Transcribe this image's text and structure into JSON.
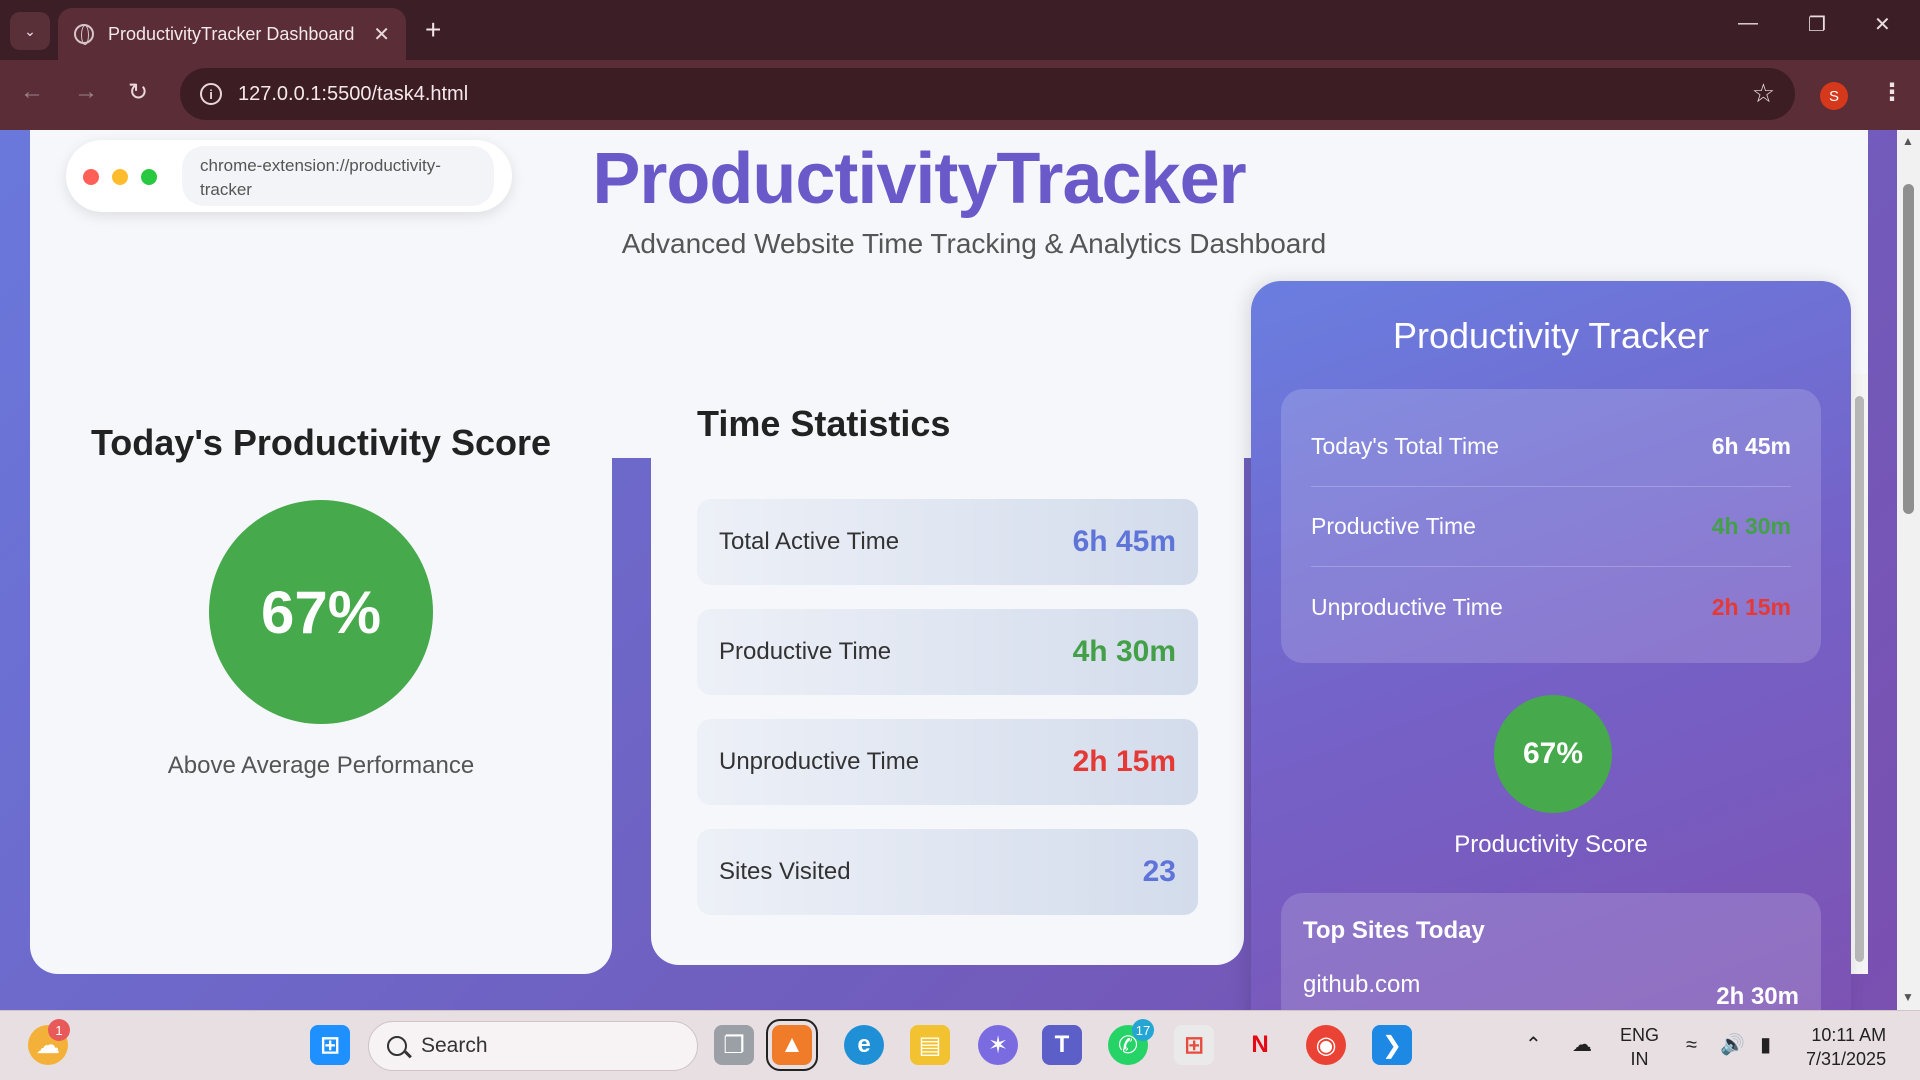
{
  "browser": {
    "tab_title": "ProductivityTracker Dashboard",
    "url": "127.0.0.1:5500/task4.html",
    "profile_initial": "S"
  },
  "header": {
    "pill_url": "chrome-extension://productivity-tracker",
    "title": "ProductivityTracker",
    "subtitle": "Advanced Website Time Tracking & Analytics Dashboard"
  },
  "score_card": {
    "title": "Today's Productivity Score",
    "score": "67%",
    "description": "Above Average Performance"
  },
  "stats_card": {
    "title": "Time Statistics",
    "rows": [
      {
        "label": "Total Active Time",
        "value": "6h 45m",
        "color": "#5f74d8"
      },
      {
        "label": "Productive Time",
        "value": "4h 30m",
        "color": "#43a047"
      },
      {
        "label": "Unproductive Time",
        "value": "2h 15m",
        "color": "#e53935"
      },
      {
        "label": "Sites Visited",
        "value": "23",
        "color": "#5f74d8"
      }
    ]
  },
  "popup": {
    "title": "Productivity Tracker",
    "rows": [
      {
        "label": "Today's Total Time",
        "value": "6h 45m",
        "color": "#ffffff"
      },
      {
        "label": "Productive Time",
        "value": "4h 30m",
        "color": "#43a047"
      },
      {
        "label": "Unproductive Time",
        "value": "2h 15m",
        "color": "#e53935"
      }
    ],
    "score": "67%",
    "score_label": "Productivity Score",
    "top_sites_title": "Top Sites Today",
    "top_site": {
      "name": "github.com",
      "time": "2h 30m"
    }
  },
  "taskbar": {
    "search_placeholder": "Search",
    "weather_badge": "1",
    "whatsapp_badge": "17",
    "language_line1": "ENG",
    "language_line2": "IN",
    "time": "10:11 AM",
    "date": "7/31/2025"
  }
}
